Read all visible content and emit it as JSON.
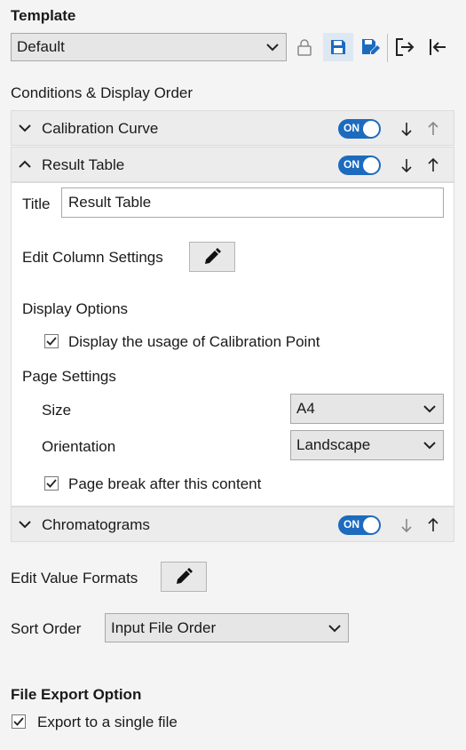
{
  "template": {
    "heading": "Template",
    "selected": "Default"
  },
  "conditions": {
    "heading": "Conditions & Display Order",
    "sections": [
      {
        "label": "Calibration Curve",
        "toggle": "ON",
        "expanded": false
      },
      {
        "label": "Result Table",
        "toggle": "ON",
        "expanded": true
      },
      {
        "label": "Chromatograms",
        "toggle": "ON",
        "expanded": false
      }
    ]
  },
  "result_table": {
    "title_label": "Title",
    "title_value": "Result Table",
    "edit_columns_label": "Edit Column Settings",
    "display_options_heading": "Display Options",
    "display_usage_label": "Display the usage of Calibration Point",
    "page_settings_heading": "Page Settings",
    "size_label": "Size",
    "size_value": "A4",
    "orientation_label": "Orientation",
    "orientation_value": "Landscape",
    "page_break_label": "Page break after this content"
  },
  "edit_value_formats_label": "Edit Value Formats",
  "sort_order": {
    "label": "Sort Order",
    "value": "Input File Order"
  },
  "file_export": {
    "heading": "File Export Option",
    "single_file_label": "Export to a single file"
  },
  "colors": {
    "accent": "#1c6bbf",
    "toggle_on": "#1c6bbf"
  }
}
